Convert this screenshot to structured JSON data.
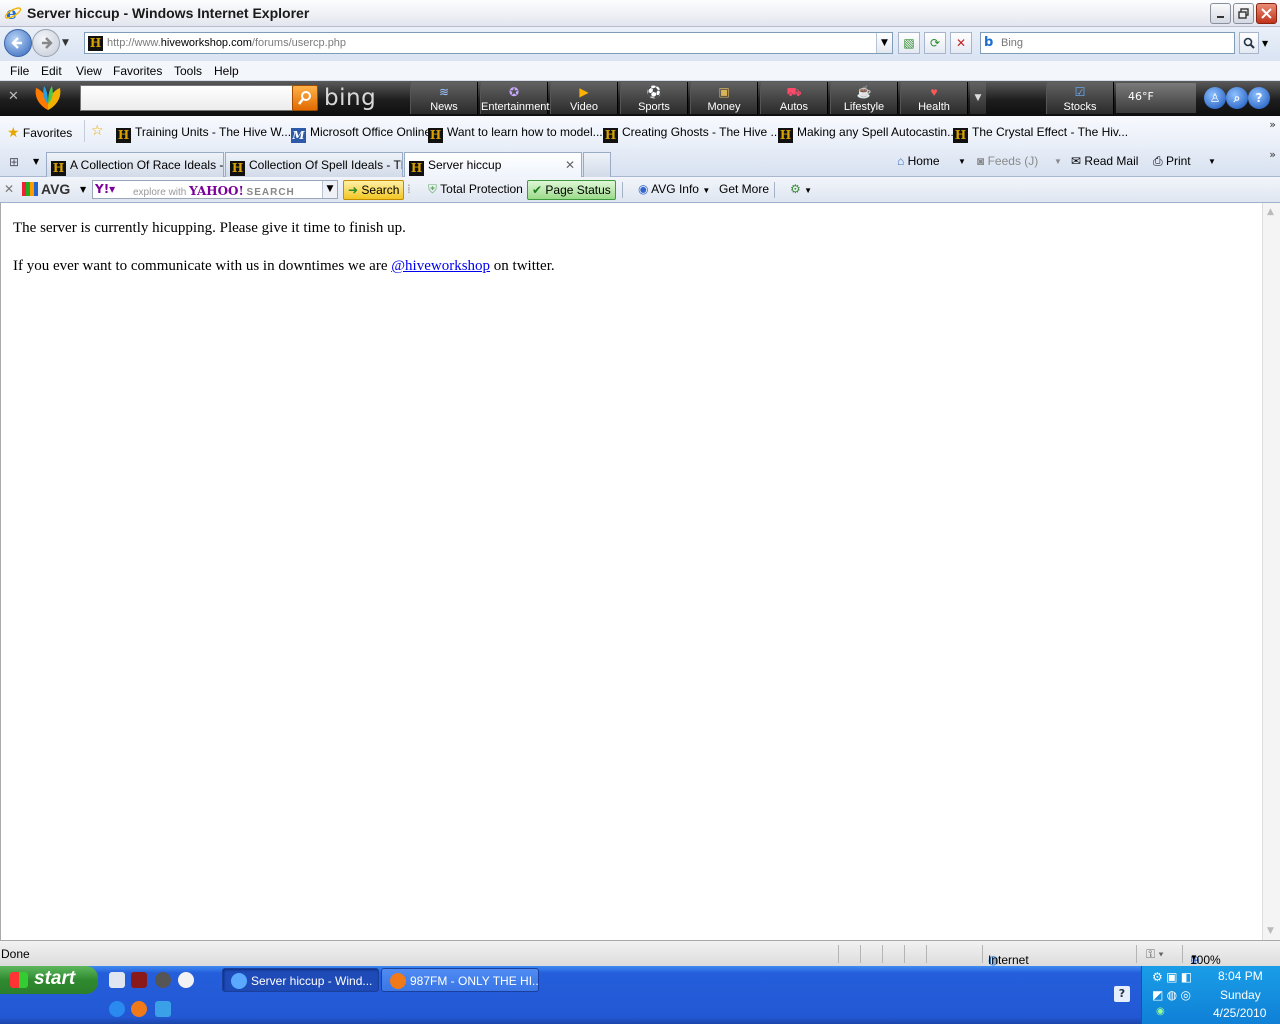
{
  "window": {
    "title": "Server hiccup - Windows Internet Explorer"
  },
  "address_bar": {
    "url_prefix": "http://www.",
    "url_domain": "hiveworkshop.com",
    "url_path": "/forums/usercp.php"
  },
  "search": {
    "placeholder": "Bing"
  },
  "menu": [
    "File",
    "Edit",
    "View",
    "Favorites",
    "Tools",
    "Help"
  ],
  "msn_toolbar": {
    "logo": "bing",
    "categories": [
      "News",
      "Entertainment",
      "Video",
      "Sports",
      "Money",
      "Autos",
      "Lifestyle",
      "Health",
      "Stocks"
    ],
    "weather": "46°F"
  },
  "favorites_bar": {
    "label": "Favorites",
    "items": [
      "Training Units - The Hive W...",
      "Microsoft Office Online",
      "Want to learn how to model...",
      "Creating Ghosts - The Hive ...",
      "Making any Spell Autocastin...",
      "The Crystal Effect - The Hiv..."
    ]
  },
  "tabs": [
    "A Collection Of Race Ideals - ...",
    "Collection Of Spell Ideals - Th...",
    "Server hiccup"
  ],
  "command_bar": {
    "home": "Home",
    "feeds": "Feeds (J)",
    "read_mail": "Read Mail",
    "print": "Print"
  },
  "avg_toolbar": {
    "logo": "AVG",
    "explore_with": "explore with",
    "yahoo": "YAHOO!",
    "search_word": "SEARCH",
    "search_button": "Search",
    "total_protection": "Total Protection",
    "page_status": "Page Status",
    "avg_info": "AVG Info",
    "get_more": "Get More"
  },
  "page": {
    "line1": "The server is currently hicupping. Please give it time to finish up.",
    "line2_before": "If you ever want to communicate with us in downtimes we are",
    "line2_link": "@hiveworkshop",
    "line2_after": "on twitter."
  },
  "status_bar": {
    "status": "Done",
    "zone": "Internet",
    "zoom": "100%"
  },
  "taskbar": {
    "start": "start",
    "tasks": [
      "Server hiccup - Wind...",
      "987FM - ONLY THE HI..."
    ],
    "clock": {
      "time": "8:04 PM",
      "day": "Sunday",
      "date": "4/25/2010"
    }
  },
  "colors": {
    "link": "#0000ee",
    "taskbar": "#245edb",
    "start_button": "#2f8a2f"
  }
}
